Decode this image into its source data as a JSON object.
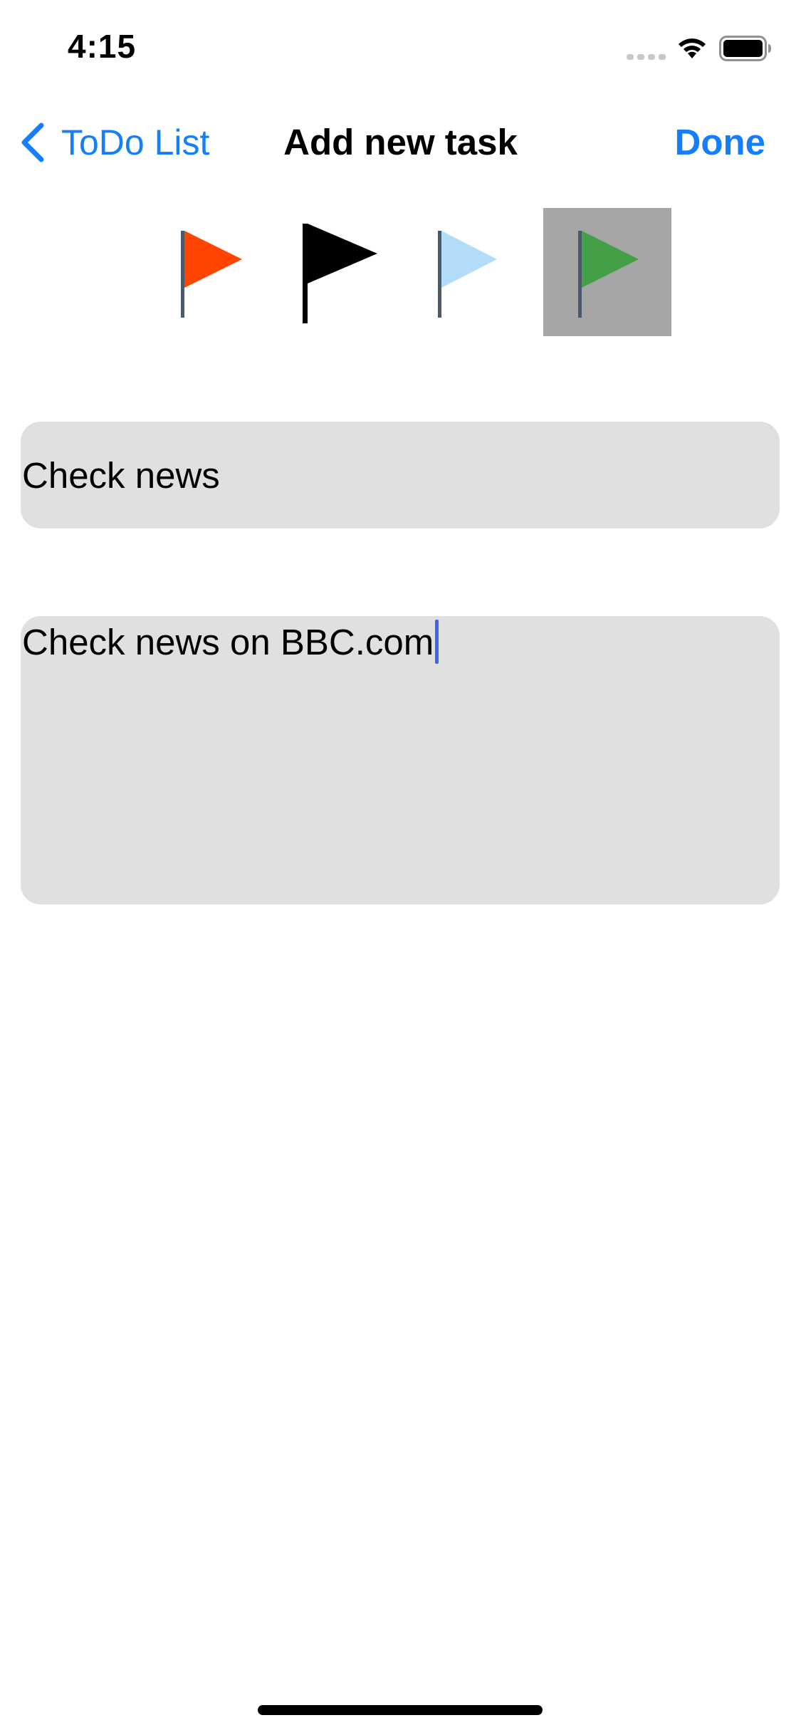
{
  "status_bar": {
    "time": "4:15",
    "icons": [
      "cellular-signal-icon",
      "wifi-icon",
      "battery-icon"
    ]
  },
  "nav": {
    "back_label": "ToDo List",
    "title": "Add new task",
    "done_label": "Done",
    "accent_color": "#147efb"
  },
  "flags": [
    {
      "name": "red-flag-icon",
      "color": "#ff4500",
      "selected": false
    },
    {
      "name": "black-flag-icon",
      "color": "#000000",
      "selected": false
    },
    {
      "name": "light-blue-flag-icon",
      "color": "#b3dcf8",
      "selected": false
    },
    {
      "name": "green-flag-icon",
      "color": "#43a047",
      "selected": true
    }
  ],
  "form": {
    "title_value": "Check news",
    "notes_value": "Check news on BBC.com",
    "field_background": "#e0e0e0",
    "selected_flag_background": "#a6a6a6"
  }
}
